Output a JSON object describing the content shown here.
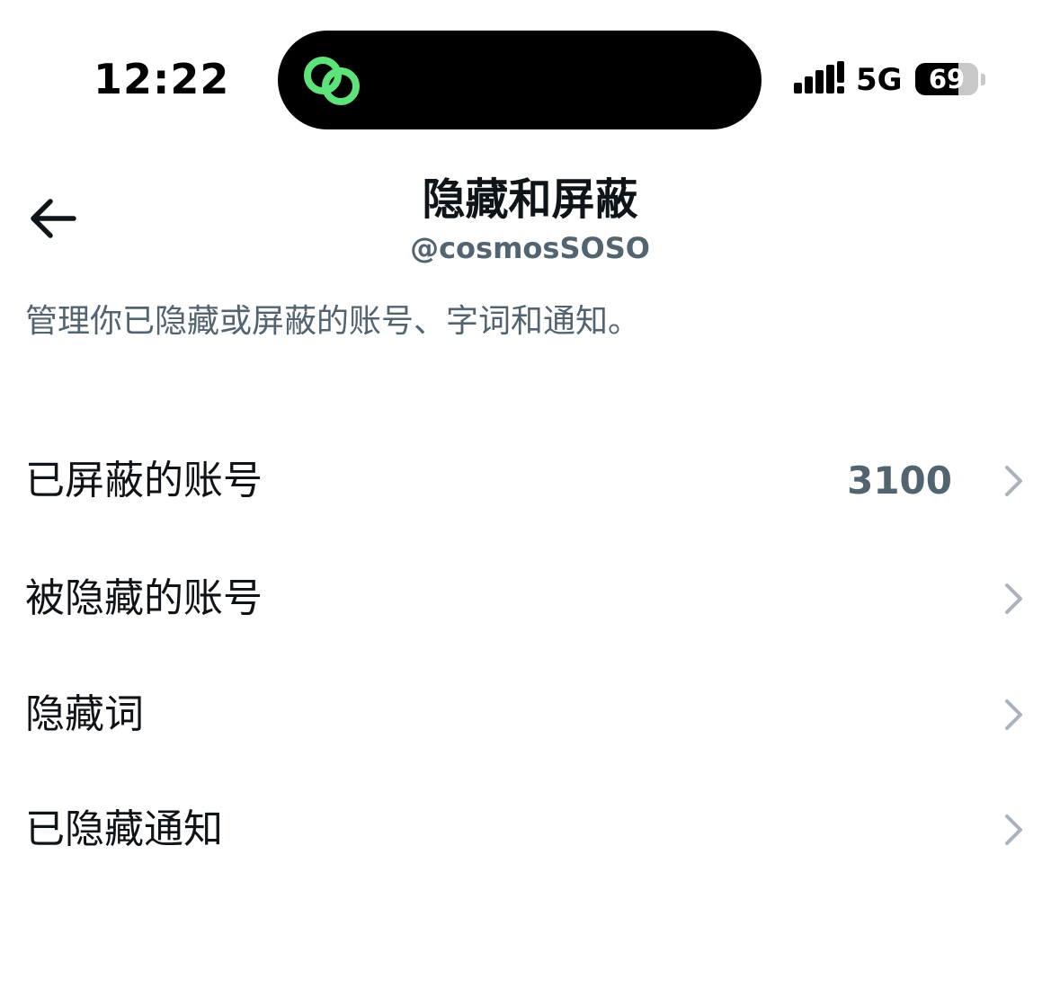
{
  "status_bar": {
    "time": "12:22",
    "network": "5G",
    "battery": "69",
    "battery_level": 0.69,
    "island_icon": "link-rings-icon"
  },
  "header": {
    "title": "隐藏和屏蔽",
    "subtitle": "@cosmosSOSO",
    "back_icon": "arrow-left-icon"
  },
  "description": "管理你已隐藏或屏蔽的账号、字词和通知。",
  "menu": {
    "items": [
      {
        "label": "已屏蔽的账号",
        "count": "3100"
      },
      {
        "label": "被隐藏的账号"
      },
      {
        "label": "隐藏词"
      },
      {
        "label": "已隐藏通知"
      }
    ]
  },
  "colors": {
    "text_primary": "#0f1419",
    "text_secondary": "#536471",
    "chevron": "#a9b3bc",
    "island_icon": "#5de37a"
  }
}
